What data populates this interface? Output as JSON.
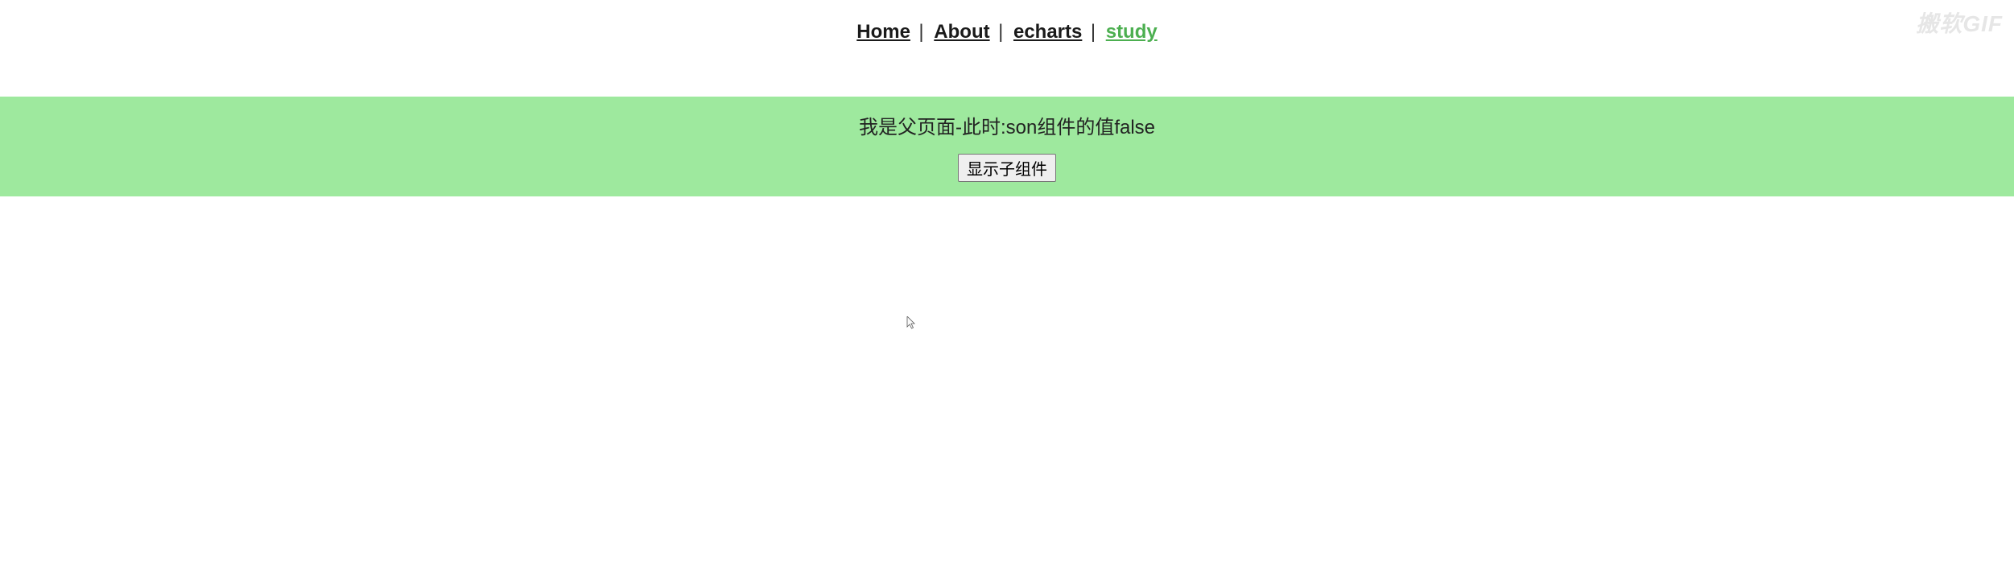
{
  "nav": {
    "items": [
      {
        "label": "Home",
        "active": false
      },
      {
        "label": "About",
        "active": false
      },
      {
        "label": "echarts",
        "active": false
      },
      {
        "label": "study",
        "active": true
      }
    ],
    "separator": " | "
  },
  "panel": {
    "text": "我是父页面-此时:son组件的值false",
    "button_label": "显示子组件"
  },
  "watermark": "搬软GIF"
}
